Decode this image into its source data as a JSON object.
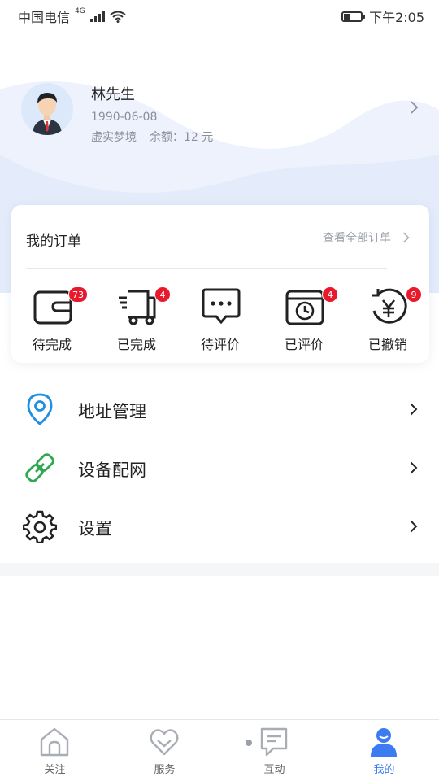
{
  "status_bar": {
    "carrier": "中国电信",
    "network": "4G",
    "time": "下午2:05",
    "battery_level": 0.35
  },
  "profile": {
    "name": "林先生",
    "birthday": "1990-06-08",
    "nickname": "虚实梦境",
    "balance": "余额：12 元"
  },
  "orders": {
    "title": "我的订单",
    "view_all": "查看全部订单",
    "items": [
      {
        "label": "待完成",
        "badge": "73",
        "icon": "wallet-icon"
      },
      {
        "label": "已完成",
        "badge": "4",
        "icon": "delivery-truck-icon"
      },
      {
        "label": "待评价",
        "badge": "",
        "icon": "chat-bubble-icon"
      },
      {
        "label": "已评价",
        "badge": "4",
        "icon": "calendar-clock-icon"
      },
      {
        "label": "已撤销",
        "badge": "9",
        "icon": "yen-refund-icon"
      }
    ]
  },
  "menu": [
    {
      "label": "地址管理",
      "icon": "location-pin-icon",
      "color": "#1e8fe1"
    },
    {
      "label": "设备配网",
      "icon": "link-icon",
      "color": "#2fa84f"
    },
    {
      "label": "设置",
      "icon": "gear-icon",
      "color": "#222222"
    }
  ],
  "bottom_nav": [
    {
      "label": "关注",
      "icon": "home-icon",
      "active": false
    },
    {
      "label": "服务",
      "icon": "heart-icon",
      "active": false
    },
    {
      "label": "互动",
      "icon": "message-icon",
      "active": false
    },
    {
      "label": "我的",
      "icon": "user-icon",
      "active": true
    }
  ],
  "colors": {
    "accent": "#3c7cf0",
    "badge": "#e8192c",
    "wave": "#e4ecfb"
  }
}
